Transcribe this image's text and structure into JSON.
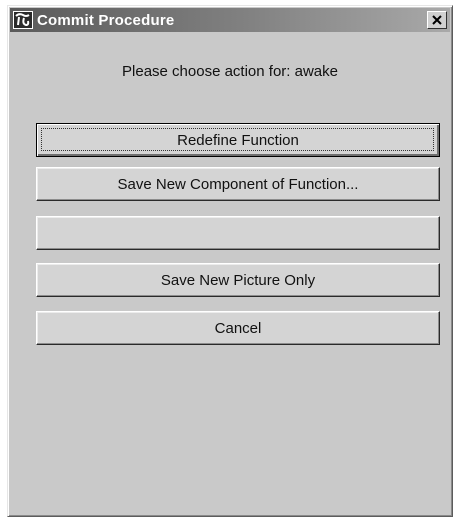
{
  "window": {
    "title": "Commit Procedure",
    "app_icon": "procedure-app-icon",
    "close_icon": "close-x-icon"
  },
  "dialog": {
    "prompt": "Please choose action for: awake",
    "buttons": {
      "redefine": "Redefine Function",
      "save_component": "Save New Component of Function...",
      "blank": "",
      "save_picture": "Save New Picture Only",
      "cancel": "Cancel"
    }
  },
  "colors": {
    "face": "#c9c9c9",
    "title_start": "#5a5a5a",
    "title_end": "#a9a9a9"
  }
}
